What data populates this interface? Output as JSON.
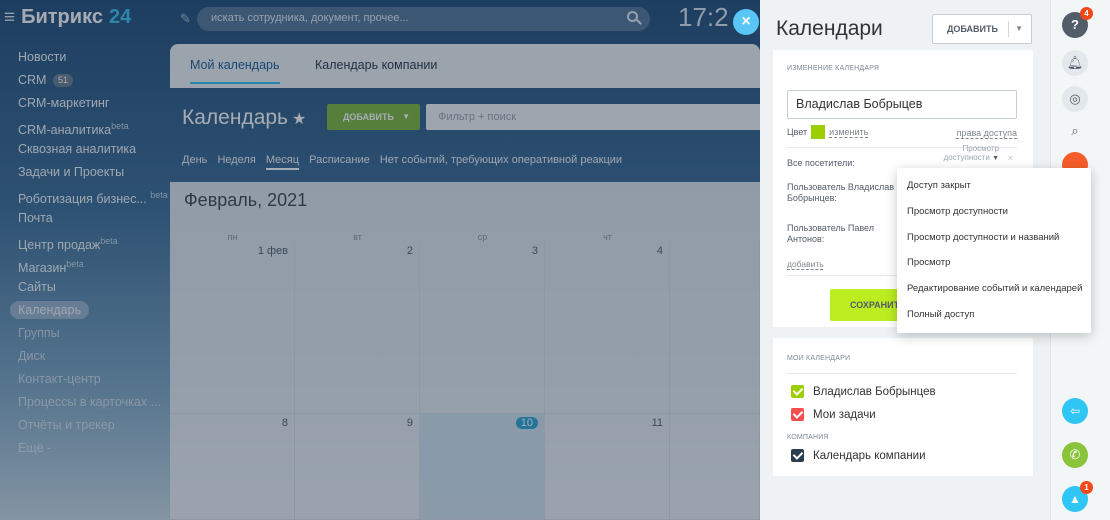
{
  "app": {
    "logo_prefix": "Битрикс",
    "logo_num": "24",
    "search_placeholder": "искать сотрудника, документ, прочее...",
    "clock": "17:2"
  },
  "menu": {
    "items": [
      {
        "label": "Новости"
      },
      {
        "label": "CRM",
        "badge": "51"
      },
      {
        "label": "CRM-маркетинг"
      },
      {
        "label": "CRM-аналитика",
        "sup": "beta"
      },
      {
        "label": "Сквозная аналитика"
      },
      {
        "label": "Задачи и Проекты"
      },
      {
        "label": "Роботизация бизнес...",
        "sup": "beta"
      },
      {
        "label": "Почта"
      },
      {
        "label": "Центр продаж",
        "sup": "beta"
      },
      {
        "label": "Магазин",
        "sup": "beta"
      },
      {
        "label": "Сайты"
      },
      {
        "label": "Календарь",
        "active": true
      },
      {
        "label": "Группы"
      },
      {
        "label": "Диск"
      },
      {
        "label": "Контакт-центр"
      },
      {
        "label": "Процессы в карточках ..."
      },
      {
        "label": "Отчёты и трекер"
      },
      {
        "label": "Ещё -"
      }
    ]
  },
  "calendar": {
    "tabs": [
      "Мой календарь",
      "Календарь компании"
    ],
    "title": "Календарь",
    "add_label": "ДОБАВИТЬ",
    "filter_placeholder": "Фильтр + поиск",
    "views": [
      "День",
      "Неделя",
      "Месяц",
      "Расписание",
      "Нет событий, требующих оперативной реакции"
    ],
    "month_title": "Февраль, 2021",
    "weekdays": [
      "пн",
      "вт",
      "ср",
      "чт"
    ],
    "week1": [
      "1 фев",
      "2",
      "3",
      "4"
    ],
    "week2": [
      "8",
      "9",
      "10",
      "11"
    ]
  },
  "panel": {
    "title": "Календари",
    "add_label": "ДОБАВИТЬ",
    "edit_section": "ИЗМЕНЕНИЕ КАЛЕНДАРЯ",
    "name_value": "Владислав Бобрыцев",
    "color_label": "Цвет",
    "color_change": "изменить",
    "color_value": "#9dcf00",
    "access_link": "права доступа",
    "all_visitors": "Все посетители:",
    "access_value": "Просмотр доступности",
    "user1": "Пользователь Владислав Бобрынцев:",
    "user2": "Пользователь Павел Антонов:",
    "add_link": "добавить",
    "save_label": "СОХРАНИТЬ",
    "my_calendars_section": "МОИ КАЛЕНДАРИ",
    "my_calendars": [
      {
        "label": "Владислав Бобрынцев",
        "color": "#9dcf00"
      },
      {
        "label": "Мои задачи",
        "color": "#f54e4e"
      }
    ],
    "company_section": "КОМПАНИЯ",
    "company_calendars": [
      {
        "label": "Календарь компании",
        "color": "#2b3e50"
      }
    ]
  },
  "access_dropdown": {
    "options": [
      "Доступ закрыт",
      "Просмотр доступности",
      "Просмотр доступности и названий",
      "Просмотр",
      "Редактирование событий и календарей",
      "Полный доступ"
    ]
  },
  "right_bar": {
    "help_badge": "4",
    "bottom_badge": "1"
  }
}
